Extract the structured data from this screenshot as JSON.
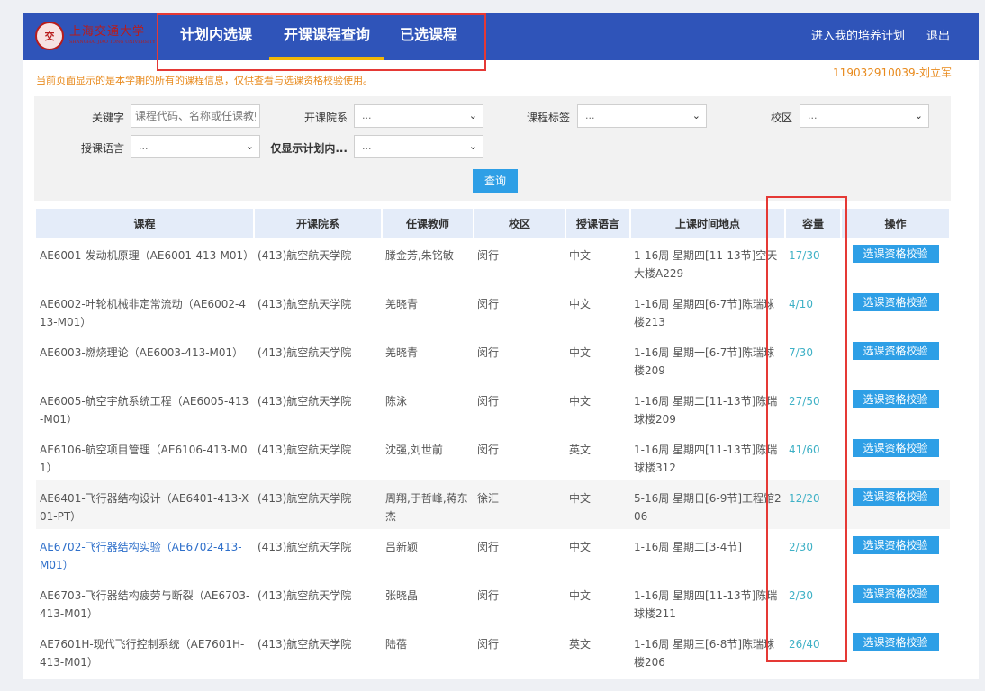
{
  "header": {
    "logo_text": "上海交通大学",
    "logo_sub": "SHANGHAI JIAO TONG UNIVERSITY",
    "tabs": [
      "计划内选课",
      "开课课程查询",
      "已选课程"
    ],
    "active_tab": 1,
    "links": [
      "进入我的培养计划",
      "退出"
    ]
  },
  "notice": "当前页面显示的是本学期的所有的课程信息，仅供查看与选课资格校验使用。",
  "user": "119032910039-刘立军",
  "search": {
    "keyword_label": "关键字",
    "keyword_placeholder": "课程代码、名称或任课教师",
    "dept_label": "开课院系",
    "tag_label": "课程标签",
    "campus_label": "校区",
    "lang_label": "授课语言",
    "plan_only_label": "仅显示计划内...",
    "select_default": "...",
    "query_button": "查询"
  },
  "table": {
    "headers": [
      "课程",
      "开课院系",
      "任课教师",
      "校区",
      "授课语言",
      "上课时间地点",
      "容量",
      "操作"
    ],
    "action_label": "选课资格校验",
    "rows": [
      {
        "course": "AE6001-发动机原理（AE6001-413-M01）",
        "dept": "(413)航空航天学院",
        "teacher": "滕金芳,朱铭敏",
        "campus": "闵行",
        "lang": "中文",
        "time": "1-16周 星期四[11-13节]空天大楼A229",
        "capacity": "17/30"
      },
      {
        "course": "AE6002-叶轮机械非定常流动（AE6002-413-M01）",
        "dept": "(413)航空航天学院",
        "teacher": "羌晓青",
        "campus": "闵行",
        "lang": "中文",
        "time": "1-16周 星期四[6-7节]陈瑞球楼213",
        "capacity": "4/10"
      },
      {
        "course": "AE6003-燃烧理论（AE6003-413-M01）",
        "dept": "(413)航空航天学院",
        "teacher": "羌晓青",
        "campus": "闵行",
        "lang": "中文",
        "time": "1-16周 星期一[6-7节]陈瑞球楼209",
        "capacity": "7/30"
      },
      {
        "course": "AE6005-航空宇航系统工程（AE6005-413-M01）",
        "dept": "(413)航空航天学院",
        "teacher": "陈泳",
        "campus": "闵行",
        "lang": "中文",
        "time": "1-16周 星期二[11-13节]陈瑞球楼209",
        "capacity": "27/50"
      },
      {
        "course": "AE6106-航空项目管理（AE6106-413-M01）",
        "dept": "(413)航空航天学院",
        "teacher": "沈强,刘世前",
        "campus": "闵行",
        "lang": "英文",
        "time": "1-16周 星期四[11-13节]陈瑞球楼312",
        "capacity": "41/60"
      },
      {
        "course": "AE6401-飞行器结构设计（AE6401-413-X01-PT）",
        "dept": "(413)航空航天学院",
        "teacher": "周翔,于哲峰,蒋东杰",
        "campus": "徐汇",
        "lang": "中文",
        "time": "5-16周 星期日[6-9节]工程馆206",
        "capacity": "12/20"
      },
      {
        "course": "AE6702-飞行器结构实验（AE6702-413-M01）",
        "dept": "(413)航空航天学院",
        "teacher": "吕新颖",
        "campus": "闵行",
        "lang": "中文",
        "time": "1-16周 星期二[3-4节]",
        "capacity": "2/30"
      },
      {
        "course": "AE6703-飞行器结构疲劳与断裂（AE6703-413-M01）",
        "dept": "(413)航空航天学院",
        "teacher": "张晓晶",
        "campus": "闵行",
        "lang": "中文",
        "time": "1-16周 星期四[11-13节]陈瑞球楼211",
        "capacity": "2/30"
      },
      {
        "course": "AE7601H-现代飞行控制系统（AE7601H-413-M01）",
        "dept": "(413)航空航天学院",
        "teacher": "陆蓓",
        "campus": "闵行",
        "lang": "英文",
        "time": "1-16周 星期三[6-8节]陈瑞球楼206",
        "capacity": "26/40"
      }
    ]
  }
}
